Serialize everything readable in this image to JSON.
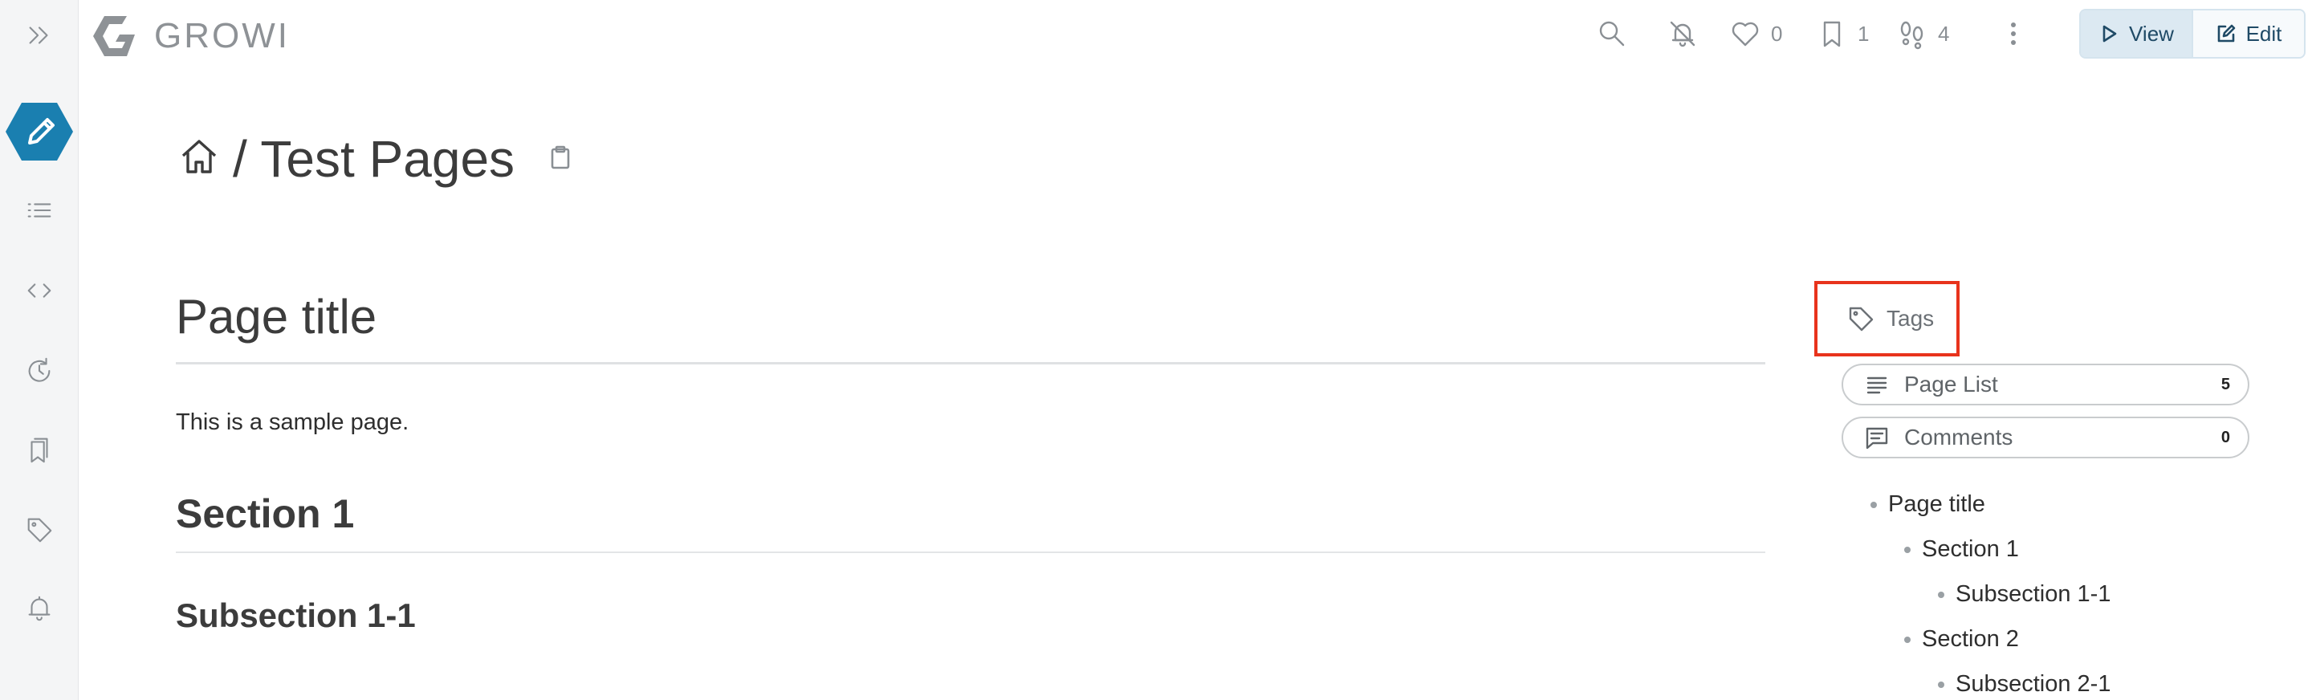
{
  "app": {
    "logo_text": "GROWI"
  },
  "topbar": {
    "likes_count": "0",
    "bookmarks_count": "1",
    "seen_users_count": "4",
    "view_label": "View",
    "edit_label": "Edit"
  },
  "page": {
    "path": "/ Test Pages",
    "h1": "Page title",
    "paragraph": "This is a sample page.",
    "section1": "Section 1",
    "subsection11": "Subsection 1-1"
  },
  "right_panel": {
    "tags_label": "Tags",
    "page_list_label": "Page List",
    "page_list_count": "5",
    "comments_label": "Comments",
    "comments_count": "0",
    "toc": [
      {
        "label": "Page title"
      },
      {
        "label": "Section 1"
      },
      {
        "label": "Subsection 1-1"
      },
      {
        "label": "Section 2"
      },
      {
        "label": "Subsection 2-1"
      }
    ]
  },
  "colors": {
    "accent": "#1a7fb0",
    "highlight_box": "#e8331c"
  }
}
